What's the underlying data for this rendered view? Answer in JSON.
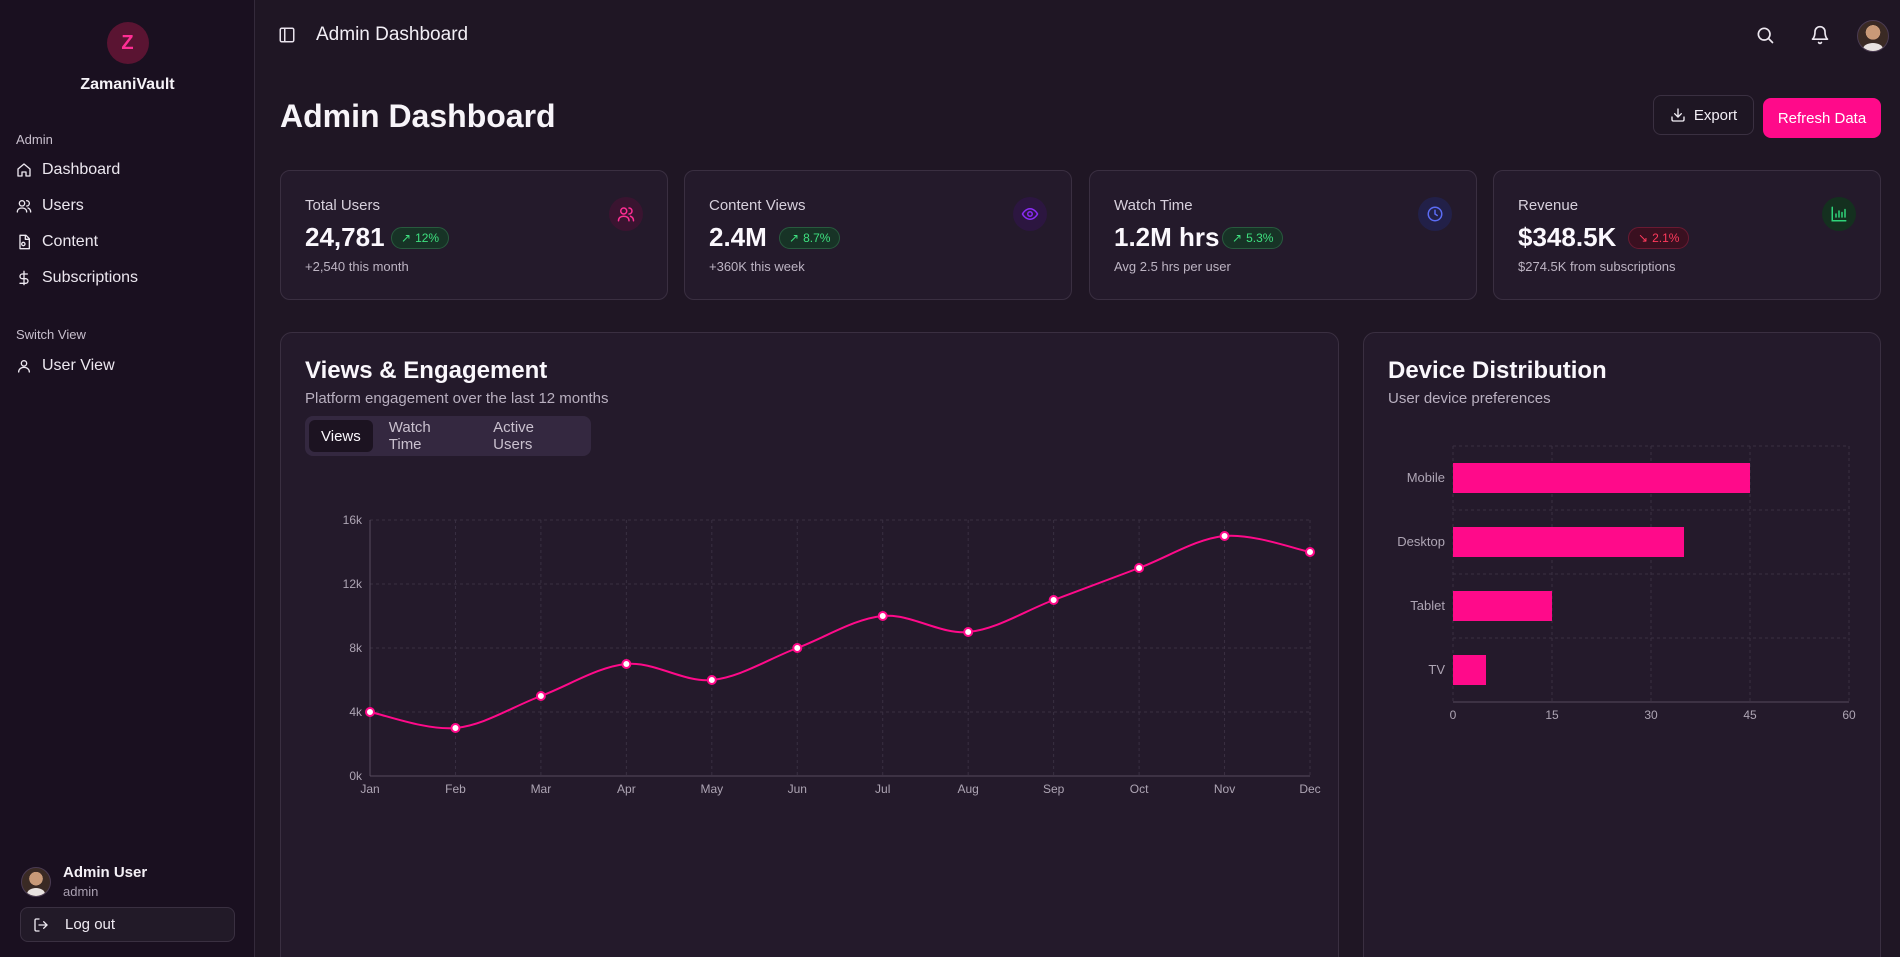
{
  "sidebar": {
    "brand": {
      "logo_letter": "Z",
      "name": "ZamaniVault"
    },
    "sections": [
      {
        "label": "Admin"
      },
      {
        "label": "Switch View"
      }
    ],
    "items": [
      {
        "label": "Dashboard",
        "icon": "home-icon"
      },
      {
        "label": "Users",
        "icon": "users-icon"
      },
      {
        "label": "Content",
        "icon": "file-icon"
      },
      {
        "label": "Subscriptions",
        "icon": "dollar-icon"
      },
      {
        "label": "User View",
        "icon": "user-icon"
      }
    ],
    "user": {
      "name": "Admin User",
      "role": "admin"
    },
    "logout_label": "Log out"
  },
  "topbar": {
    "title": "Admin Dashboard",
    "icons": [
      "sidebar-toggle-icon",
      "search-icon",
      "bell-icon"
    ]
  },
  "header": {
    "title": "Admin Dashboard",
    "export_label": "Export",
    "refresh_label": "Refresh Data"
  },
  "stats": [
    {
      "label": "Total Users",
      "value": "24,781",
      "change": "12%",
      "direction": "up",
      "sub": "+2,540 this month",
      "icon": "users-icon",
      "accent": "#ff2e94"
    },
    {
      "label": "Content Views",
      "value": "2.4M",
      "change": "8.7%",
      "direction": "up",
      "sub": "+360K this week",
      "icon": "eye-icon",
      "accent": "#8b2cf5"
    },
    {
      "label": "Watch Time",
      "value": "1.2M hrs",
      "change": "5.3%",
      "direction": "up",
      "sub": "Avg 2.5 hrs per user",
      "icon": "clock-icon",
      "accent": "#5b6cf5"
    },
    {
      "label": "Revenue",
      "value": "$348.5K",
      "change": "2.1%",
      "direction": "down",
      "sub": "$274.5K from subscriptions",
      "icon": "bar-chart-icon",
      "accent": "#2fd47a"
    }
  ],
  "engagement": {
    "title": "Views & Engagement",
    "subtitle": "Platform engagement over the last 12 months",
    "tabs": [
      {
        "label": "Views",
        "active": true
      },
      {
        "label": "Watch Time",
        "active": false
      },
      {
        "label": "Active Users",
        "active": false
      }
    ]
  },
  "devices": {
    "title": "Device Distribution",
    "subtitle": "User device preferences"
  },
  "colors": {
    "accent": "#ff0a8a",
    "background": "#1f1624",
    "card": "#241a2b"
  },
  "chart_data": [
    {
      "type": "line",
      "categories": [
        "Jan",
        "Feb",
        "Mar",
        "Apr",
        "May",
        "Jun",
        "Jul",
        "Aug",
        "Sep",
        "Oct",
        "Nov",
        "Dec"
      ],
      "series": [
        {
          "values": [
            4000,
            3000,
            5000,
            7000,
            6000,
            8000,
            10000,
            9000,
            11000,
            13000,
            15000,
            14000
          ]
        }
      ],
      "y_ticks": [
        "0k",
        "4k",
        "8k",
        "12k",
        "16k"
      ],
      "ylim": [
        0,
        16000
      ],
      "grid": true,
      "color": "#ff0a8a"
    },
    {
      "type": "bar",
      "orientation": "horizontal",
      "categories": [
        "Mobile",
        "Desktop",
        "Tablet",
        "TV"
      ],
      "values": [
        45,
        35,
        15,
        5
      ],
      "x_ticks": [
        "0",
        "15",
        "30",
        "45",
        "60"
      ],
      "xlim": [
        0,
        60
      ],
      "grid": true,
      "color": "#ff0a8a"
    }
  ]
}
